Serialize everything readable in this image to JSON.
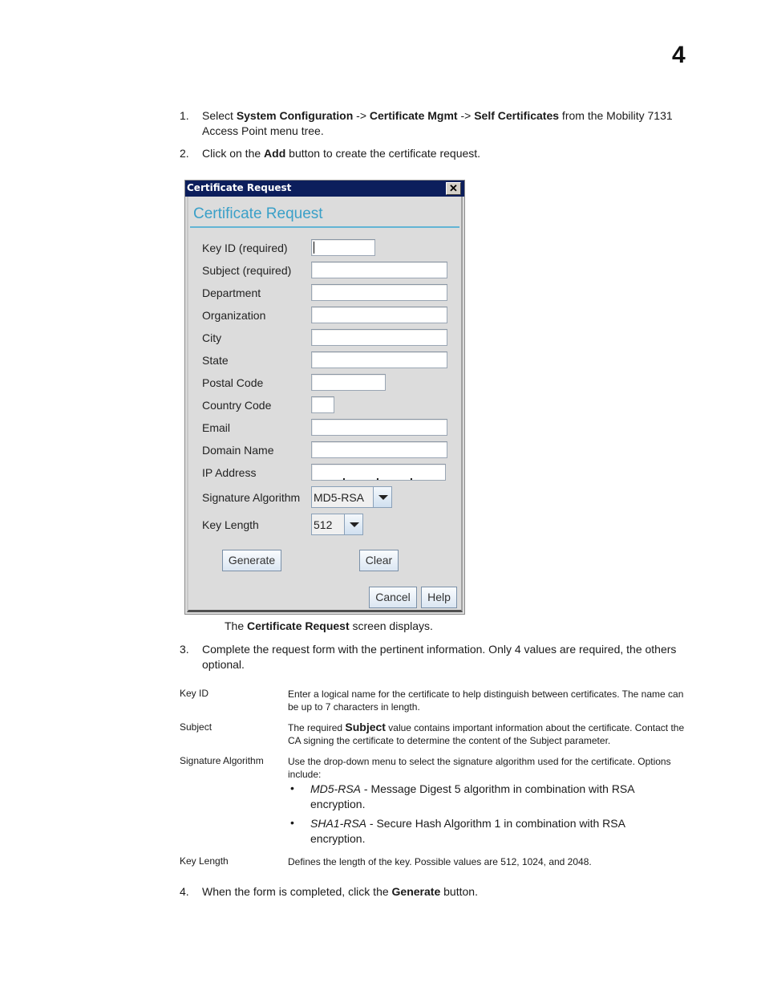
{
  "page": {
    "chapter_number": "4"
  },
  "steps": [
    {
      "number": "1.",
      "parts": {
        "a": "Select ",
        "b1": "System Configuration",
        "c": " -> ",
        "b2": "Certificate Mgmt",
        "d": " -> ",
        "b3": "Self Certificates",
        "e": " from the Mobility 7131 Access Point menu tree."
      }
    },
    {
      "number": "2.",
      "parts": {
        "a": "Click on the ",
        "b1": "Add",
        "c": " button to create the certificate request."
      }
    },
    {
      "number": "3.",
      "text": "Complete the request form with the pertinent information. Only 4 values are required, the others optional."
    },
    {
      "number": "4.",
      "parts": {
        "a": "When the form is completed, click the ",
        "b1": "Generate",
        "c": " button."
      }
    }
  ],
  "dialog": {
    "window_title": "Certificate Request",
    "close_icon": "close-icon",
    "heading": "Certificate Request",
    "fields": [
      {
        "label": "Key ID (required)",
        "value": ""
      },
      {
        "label": "Subject (required)",
        "value": ""
      },
      {
        "label": "Department",
        "value": ""
      },
      {
        "label": "Organization",
        "value": ""
      },
      {
        "label": "City",
        "value": ""
      },
      {
        "label": "State",
        "value": ""
      },
      {
        "label": "Postal Code",
        "value": ""
      },
      {
        "label": "Country Code",
        "value": ""
      },
      {
        "label": "Email",
        "value": ""
      },
      {
        "label": "Domain Name",
        "value": ""
      },
      {
        "label": "IP Address",
        "value": ". . ."
      }
    ],
    "signature_algorithm": {
      "label": "Signature Algorithm",
      "selected": "MD5-RSA"
    },
    "key_length": {
      "label": "Key Length",
      "selected": "512"
    },
    "buttons": {
      "generate": "Generate",
      "clear": "Clear",
      "cancel": "Cancel",
      "help": "Help"
    }
  },
  "caption": {
    "a": "The ",
    "b": "Certificate Request",
    "c": " screen displays."
  },
  "definitions": [
    {
      "term": "Key ID",
      "definition": "Enter a logical name for the certificate to help distinguish between certificates. The name can be up to 7 characters in length."
    },
    {
      "term": "Subject",
      "def_a": "The required ",
      "def_bold": "Subject",
      "def_c": " value contains important information about the certificate. Contact the CA signing the certificate to determine the content of the Subject parameter."
    },
    {
      "term": "Signature Algorithm",
      "definition": "Use the drop-down menu to select the signature algorithm used for the certificate. Options include:",
      "options": [
        {
          "name": "MD5-RSA",
          "desc": " - Message Digest 5 algorithm in combination with RSA encryption."
        },
        {
          "name": "SHA1-RSA",
          "desc": " - Secure Hash Algorithm 1 in combination with RSA encryption."
        }
      ]
    },
    {
      "term": "Key Length",
      "definition": "Defines the length of the key. Possible values are 512, 1024, and 2048."
    }
  ]
}
